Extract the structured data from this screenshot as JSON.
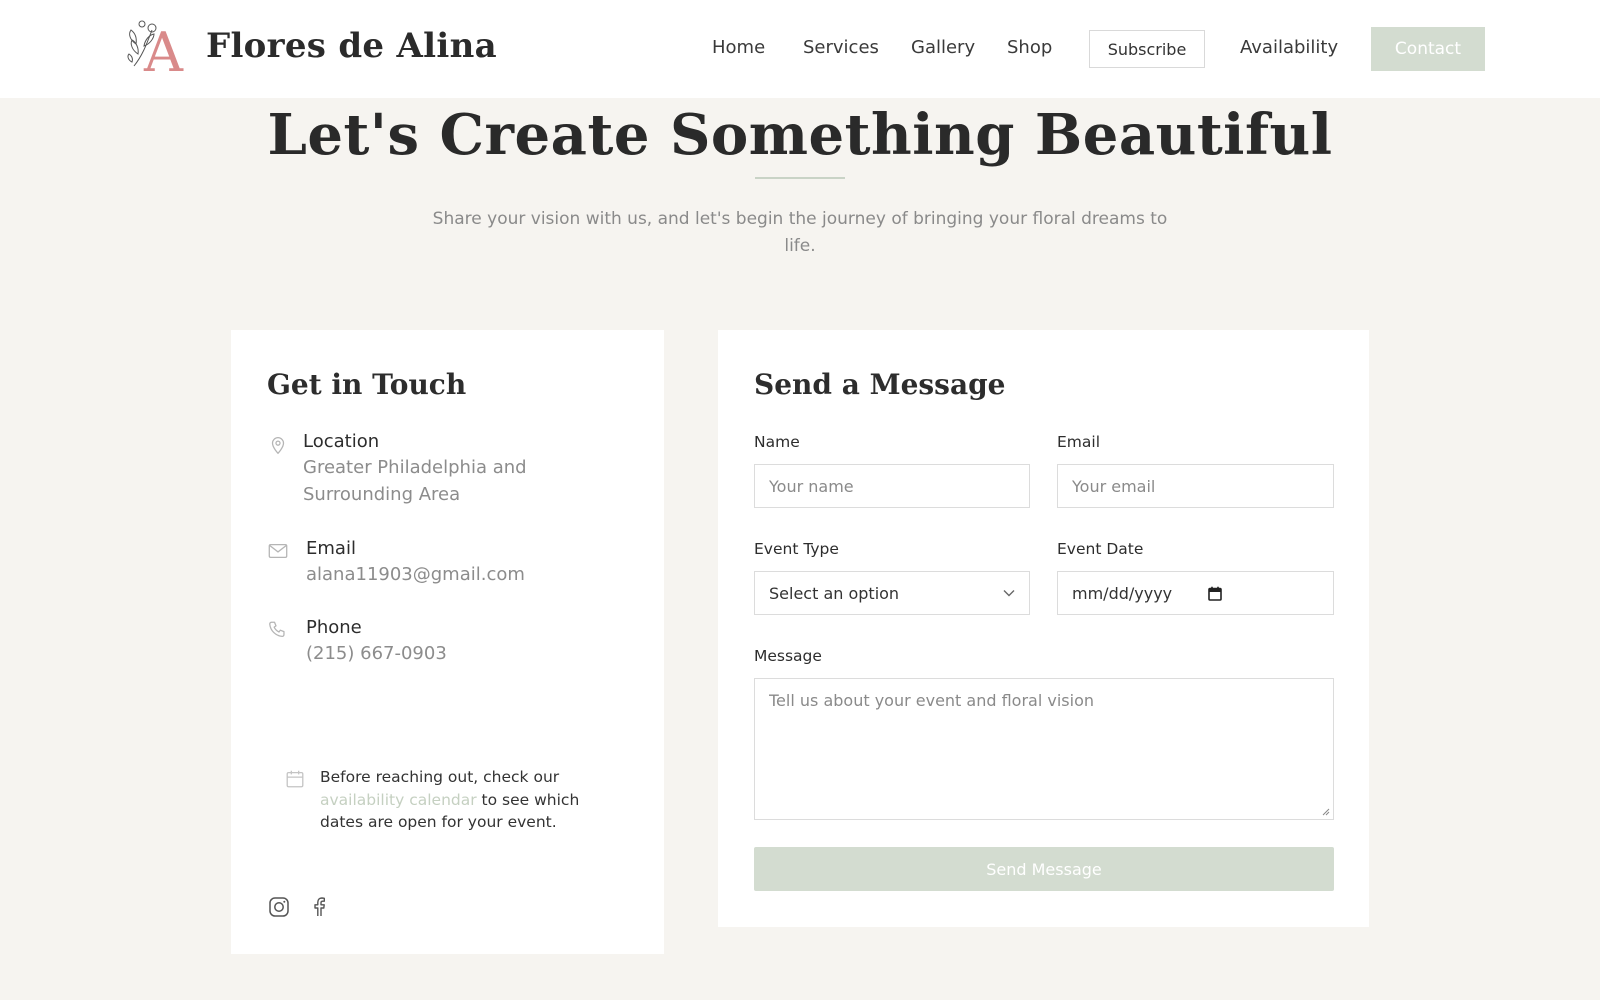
{
  "header": {
    "brand": "Flores de Alina",
    "logo_letter": "A",
    "nav": [
      "Home",
      "Services",
      "Gallery",
      "Shop"
    ],
    "subscribe_label": "Subscribe",
    "availability_label": "Availability",
    "contact_label": "Contact"
  },
  "hero": {
    "title": "Let's Create Something Beautiful",
    "subtitle": "Share your vision with us, and let's begin the journey of bringing your floral dreams to life."
  },
  "contact_info": {
    "title": "Get in Touch",
    "location_label": "Location",
    "location_value": "Greater Philadelphia and Surrounding Area",
    "email_label": "Email",
    "email_value": "alana11903@gmail.com",
    "phone_label": "Phone",
    "phone_value": "(215) 667-0903",
    "note_before": "Before reaching out, check our ",
    "note_link": "availability calendar",
    "note_after": " to see which dates are open for your event."
  },
  "form": {
    "title": "Send a Message",
    "name_label": "Name",
    "name_placeholder": "Your name",
    "email_label": "Email",
    "email_placeholder": "Your email",
    "event_type_label": "Event Type",
    "event_type_value": "Select an option",
    "event_date_label": "Event Date",
    "event_date_placeholder": "mm/dd/yyyy",
    "message_label": "Message",
    "message_placeholder": "Tell us about your event and floral vision",
    "submit_label": "Send Message"
  },
  "colors": {
    "accent": "#d3dcd0",
    "page_bg": "#f6f4f0",
    "logo_pink": "#d98a8a"
  }
}
